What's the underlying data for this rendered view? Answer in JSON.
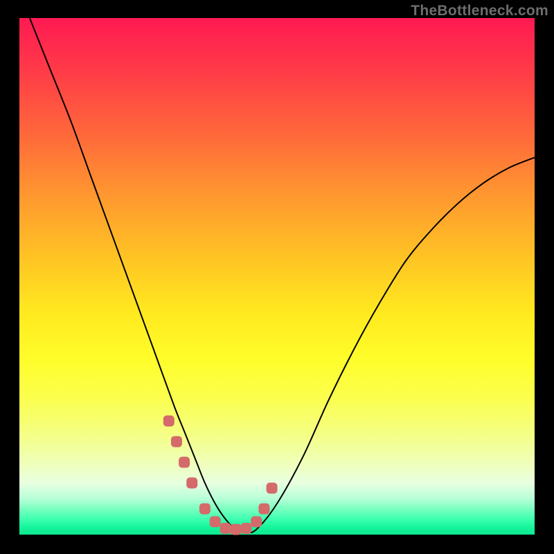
{
  "watermark": "TheBottleneck.com",
  "chart_data": {
    "type": "line",
    "title": "",
    "xlabel": "",
    "ylabel": "",
    "xlim": [
      0,
      100
    ],
    "ylim": [
      0,
      100
    ],
    "grid": false,
    "series": [
      {
        "name": "curve",
        "color": "#000000",
        "x": [
          2,
          6,
          10,
          14,
          18,
          22,
          26,
          30,
          32,
          34,
          36,
          38,
          40,
          42,
          44,
          46,
          50,
          55,
          60,
          65,
          70,
          75,
          80,
          85,
          90,
          95,
          100
        ],
        "y": [
          100,
          90,
          80,
          69,
          58,
          47,
          36,
          25,
          20,
          15,
          10,
          6,
          3,
          1,
          0.5,
          1,
          6,
          15,
          26,
          36,
          45,
          53,
          59,
          64,
          68,
          71,
          73
        ]
      },
      {
        "name": "markers",
        "type": "scatter",
        "color": "#d46a6a",
        "x": [
          29,
          30.5,
          32,
          33.5,
          36,
          38,
          40,
          42,
          44,
          46,
          47.5,
          49
        ],
        "y": [
          22,
          18,
          14,
          10,
          5,
          2.5,
          1.2,
          1,
          1.2,
          2.5,
          5,
          9
        ]
      }
    ],
    "background_gradient": {
      "top": "#ff1a52",
      "upper_mid": "#ffc224",
      "mid": "#fffd2a",
      "lower": "#17f59c"
    }
  }
}
